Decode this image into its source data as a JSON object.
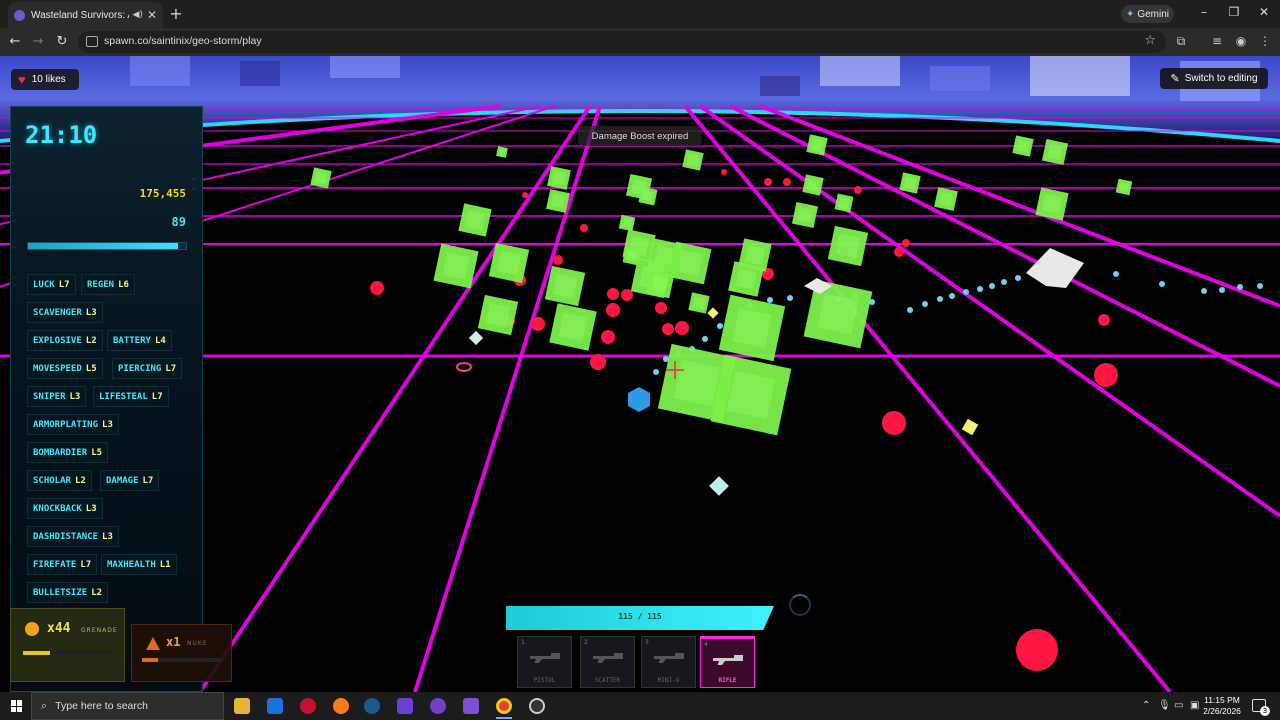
{
  "browser": {
    "tab_title": "Wasteland Survivors: Ashto",
    "url": "spawn.co/saintinix/geo-storm/play",
    "gemini_label": "Gemini"
  },
  "game": {
    "likes": "10 likes",
    "edit_button": "Switch to editing",
    "toast": "Damage Boost expired",
    "timer": "21:10",
    "score": "175,455",
    "level": "89",
    "xp_fraction": 0.95,
    "upgrades": [
      {
        "name": "LUCK",
        "level": "L7"
      },
      {
        "name": "REGEN",
        "level": "L6"
      },
      {
        "name": "SCAVENGER",
        "level": "L3"
      },
      {
        "name": "EXPLOSIVE",
        "level": "L2"
      },
      {
        "name": "BATTERY",
        "level": "L4"
      },
      {
        "name": "MOVESPEED",
        "level": "L5"
      },
      {
        "name": "PIERCING",
        "level": "L7"
      },
      {
        "name": "SNIPER",
        "level": "L3"
      },
      {
        "name": "LIFESTEAL",
        "level": "L7"
      },
      {
        "name": "ARMORPLATING",
        "level": "L3"
      },
      {
        "name": "BOMBARDIER",
        "level": "L5"
      },
      {
        "name": "SCHOLAR",
        "level": "L2"
      },
      {
        "name": "DAMAGE",
        "level": "L7"
      },
      {
        "name": "KNOCKBACK",
        "level": "L3"
      },
      {
        "name": "DASHDISTANCE",
        "level": "L3"
      },
      {
        "name": "FIREFATE",
        "level": "L7"
      },
      {
        "name": "MAXHEALTH",
        "level": "L1"
      },
      {
        "name": "BULLETSIZE",
        "level": "L2"
      }
    ],
    "grenade": {
      "count": "x44",
      "label": "GRENADE",
      "progress": 0.3
    },
    "nuke": {
      "count": "x1",
      "label": "NUKE",
      "progress": 0.2
    },
    "health": "115 / 115",
    "health_fraction": 1.0,
    "weapons": [
      {
        "slot": "1",
        "name": "PISTOL",
        "selected": false
      },
      {
        "slot": "2",
        "name": "SCATTER",
        "selected": false
      },
      {
        "slot": "3",
        "name": "MINI-G",
        "selected": false
      },
      {
        "slot": "4",
        "name": "RIFLE",
        "selected": true
      }
    ],
    "colors": {
      "grid": "#e100e1",
      "cube": "#7cf04a",
      "enemy_red": "#ff1744",
      "hud_cyan": "#3ee6ff",
      "score_yellow": "#ffd21f"
    }
  },
  "taskbar": {
    "search_placeholder": "Type here to search",
    "time": "11:15 PM",
    "date": "2/26/2026",
    "notifications": "3"
  }
}
